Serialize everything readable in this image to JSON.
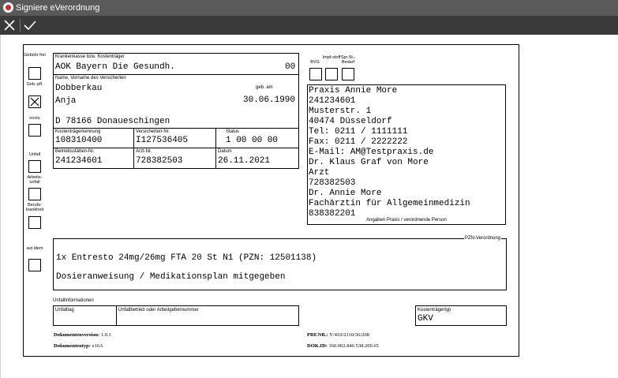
{
  "window": {
    "title": "Signiere eVerordnung"
  },
  "toolbar": {
    "cancel": "close-icon",
    "confirm": "check-icon"
  },
  "checkboxes": {
    "gebuehr_frei": {
      "label": "Gebühr frei",
      "checked": false
    },
    "geb_pfl": {
      "label": "Geb.-pfl.",
      "checked": true
    },
    "noctu": {
      "label": "noctu",
      "checked": false
    },
    "unfall": {
      "label": "Unfall",
      "checked": false
    },
    "arbeitsunfall": {
      "label": "Arbeits-unfall",
      "checked": false
    },
    "berufskrankheit": {
      "label": "Berufs-krankheit",
      "checked": false
    },
    "aut_idem": {
      "label": "aut idem",
      "checked": false
    },
    "bvg": {
      "label": "BVG",
      "checked": false
    },
    "impfstoff": {
      "label": "Impf-stoff",
      "checked": false
    },
    "spr_st_bedarf": {
      "label": "Spr.St.-Bedarf",
      "checked": false
    }
  },
  "patient": {
    "kasse_label": "Krankenkasse bzw. Kostenträger",
    "kasse": "AOK Bayern Die Gesundh.",
    "kasse_code": "00",
    "name_label": "Name, Vorname des Versicherten",
    "geb_label": "geb. am",
    "nachname": "Dobberkau",
    "vorname": "Anja",
    "geburtsdatum": "30.06.1990",
    "adresse": "D 78166 Donaueschingen",
    "kostentraeger_label": "Kostenträgerkennung",
    "kostentraeger": "108310400",
    "versnr_label": "Versicherten-Nr.",
    "versnr": "I127536405",
    "status_label": "Status",
    "status": "1 00 00 00",
    "bsnr_label": "Betriebsstätten-Nr.",
    "bsnr": "241234601",
    "arztnr_label": "Arzt-Nr.",
    "arztnr": "728382503",
    "datum_label": "Datum",
    "datum": "26.11.2021"
  },
  "praxis": {
    "lines": [
      "Praxis Annie More",
      "241234601",
      "Musterstr.  1",
      "40474 Düsseldorf",
      "Tel: 0211 / 1111111",
      "Fax: 0211 / 2222222",
      "E-Mail: AM@Testpraxis.de",
      "Dr. Klaus Graf von More",
      "Arzt",
      "728382503",
      "Dr. Annie More",
      "Fachärztin für Allgemeinmedizin",
      "838382201"
    ],
    "caption": "Angaben Praxis / verordnende Person"
  },
  "verordnung": {
    "label": "PZN-Verordnung",
    "line1": "1x Entresto 24mg/26mg FTA 20 St N1 (PZN: 12501138)",
    "line2": "Dosieranweisung / Medikationsplan mitgegeben"
  },
  "unfall": {
    "section_label": "Unfallinformationen",
    "tag_label": "Unfalltag",
    "betrieb_label": "Unfallbetrieb oder Arbeitgebernummer",
    "kostentraegertyp_label": "Kostenträgertyp",
    "kostentraegertyp": "GKV"
  },
  "footer": {
    "dokversion_label": "Dokumentenversion:",
    "dokversion": "1.0.1",
    "doktyp_label": "Dokumententyp:",
    "doktyp": "e16A",
    "prf_label": "PRF.NR.:",
    "prf": "Y/410/2110/36/208",
    "dokid_label": "DOK.ID:",
    "dokid": "160.002.846.538.200.65"
  }
}
